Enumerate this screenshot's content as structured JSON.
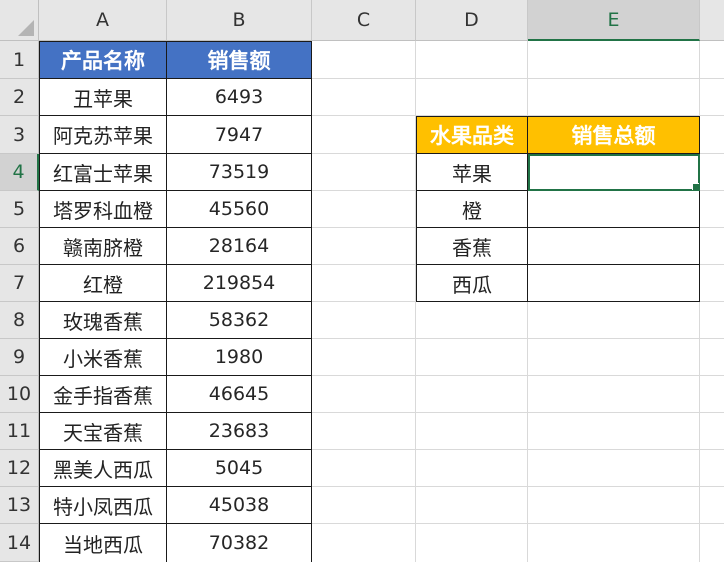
{
  "columns": [
    "A",
    "B",
    "C",
    "D",
    "E"
  ],
  "active_column": "E",
  "active_row": "4",
  "rows": [
    "1",
    "2",
    "3",
    "4",
    "5",
    "6",
    "7",
    "8",
    "9",
    "10",
    "11",
    "12",
    "13",
    "14"
  ],
  "colors": {
    "header_blue": "#4472c4",
    "header_gold": "#ffc000",
    "selection_green": "#217346"
  },
  "products_table": {
    "header_name": "产品名称",
    "header_sales": "销售额",
    "rows": [
      {
        "name": "丑苹果",
        "sales": "6493"
      },
      {
        "name": "阿克苏苹果",
        "sales": "7947"
      },
      {
        "name": "红富士苹果",
        "sales": "73519"
      },
      {
        "name": "塔罗科血橙",
        "sales": "45560"
      },
      {
        "name": "赣南脐橙",
        "sales": "28164"
      },
      {
        "name": "红橙",
        "sales": "219854"
      },
      {
        "name": "玫瑰香蕉",
        "sales": "58362"
      },
      {
        "name": "小米香蕉",
        "sales": "1980"
      },
      {
        "name": "金手指香蕉",
        "sales": "46645"
      },
      {
        "name": "天宝香蕉",
        "sales": "23683"
      },
      {
        "name": "黑美人西瓜",
        "sales": "5045"
      },
      {
        "name": "特小凤西瓜",
        "sales": "45038"
      },
      {
        "name": "当地西瓜",
        "sales": "70382"
      }
    ]
  },
  "summary_table": {
    "header_category": "水果品类",
    "header_total": "销售总额",
    "rows": [
      {
        "category": "苹果",
        "total": ""
      },
      {
        "category": "橙",
        "total": ""
      },
      {
        "category": "香蕉",
        "total": ""
      },
      {
        "category": "西瓜",
        "total": ""
      }
    ]
  }
}
